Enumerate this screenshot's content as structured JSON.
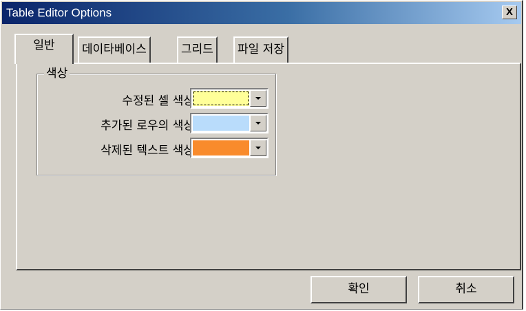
{
  "window": {
    "title": "Table Editor Options",
    "close_label": "X"
  },
  "tabs": [
    {
      "label": "일반",
      "active": true
    },
    {
      "label": "데이타베이스",
      "active": false
    },
    {
      "label": "그리드",
      "active": false
    },
    {
      "label": "파일 저장",
      "active": false
    }
  ],
  "color_group": {
    "legend": "색상",
    "rows": [
      {
        "label": "수정된 셀 색상",
        "color": "#ffff99"
      },
      {
        "label": "추가된 로우의 색상",
        "color": "#b9dcfb"
      },
      {
        "label": "삭제된 텍스트 색상",
        "color": "#f98b2c"
      }
    ]
  },
  "buttons": {
    "ok_label": "확인",
    "cancel_label": "취소"
  }
}
